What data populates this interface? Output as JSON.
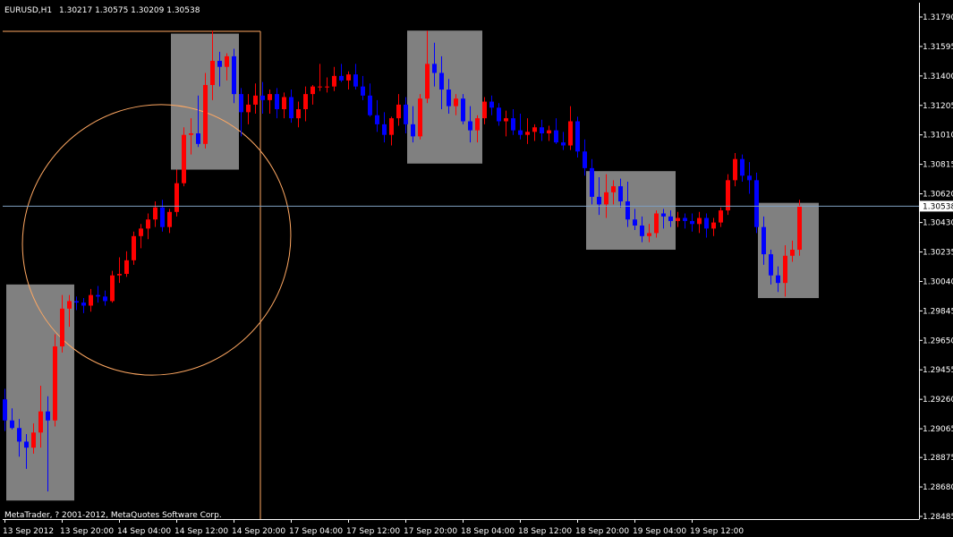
{
  "header": {
    "symbol": "EURUSD,H1",
    "ohlc": "1.30217 1.30575 1.30209 1.30538"
  },
  "copyright": "MetaTrader, ? 2001-2012, MetaQuotes Software Corp.",
  "current_price_label": "1.30538",
  "colors": {
    "background": "#000000",
    "axis": "#ffffff",
    "bull": "#ff0000",
    "bear": "#0000ff",
    "highlight": "#808080",
    "ellipse": "#ffa862",
    "price_line": "#7f9fbf"
  },
  "chart_data": {
    "type": "candlestick",
    "y_ticks": [
      "1.31790",
      "1.31595",
      "1.31400",
      "1.31205",
      "1.31010",
      "1.30815",
      "1.30620",
      "1.30430",
      "1.30235",
      "1.30040",
      "1.29845",
      "1.29650",
      "1.29455",
      "1.29260",
      "1.29065",
      "1.28875",
      "1.28680",
      "1.28485"
    ],
    "y_tick_values": [
      1.3179,
      1.31595,
      1.314,
      1.31205,
      1.3101,
      1.30815,
      1.3062,
      1.3043,
      1.30235,
      1.3004,
      1.29845,
      1.2965,
      1.29455,
      1.2926,
      1.29065,
      1.28875,
      1.2868,
      1.28485
    ],
    "ylim": [
      1.28485,
      1.3179
    ],
    "x_ticks": [
      "13 Sep 2012",
      "13 Sep 20:00",
      "14 Sep 04:00",
      "14 Sep 12:00",
      "14 Sep 20:00",
      "17 Sep 04:00",
      "17 Sep 12:00",
      "17 Sep 20:00",
      "18 Sep 04:00",
      "18 Sep 12:00",
      "18 Sep 20:00",
      "19 Sep 04:00",
      "19 Sep 12:00"
    ],
    "x_tick_positions": [
      0,
      8,
      16,
      24,
      32,
      40,
      48,
      56,
      64,
      72,
      80,
      88,
      96
    ],
    "candles": [
      [
        1.2926,
        1.2933,
        1.2905,
        1.2912
      ],
      [
        1.2912,
        1.292,
        1.2906,
        1.2907
      ],
      [
        1.2907,
        1.2913,
        1.2888,
        1.2898
      ],
      [
        1.2898,
        1.2903,
        1.288,
        1.2894
      ],
      [
        1.2894,
        1.291,
        1.289,
        1.2904
      ],
      [
        1.2904,
        1.2935,
        1.2894,
        1.2918
      ],
      [
        1.2918,
        1.2928,
        1.2865,
        1.2912
      ],
      [
        1.2912,
        1.2969,
        1.2908,
        1.2961
      ],
      [
        1.2961,
        1.2995,
        1.2957,
        1.2986
      ],
      [
        1.2986,
        1.2995,
        1.2974,
        1.2991
      ],
      [
        1.2991,
        1.2994,
        1.2985,
        1.299
      ],
      [
        1.299,
        1.2993,
        1.2983,
        1.2988
      ],
      [
        1.2988,
        1.2999,
        1.2984,
        1.2995
      ],
      [
        1.2995,
        1.3001,
        1.299,
        1.2994
      ],
      [
        1.2994,
        1.2998,
        1.2988,
        1.2991
      ],
      [
        1.2991,
        1.3011,
        1.299,
        1.3008
      ],
      [
        1.3008,
        1.302,
        1.3003,
        1.3009
      ],
      [
        1.3009,
        1.3024,
        1.3007,
        1.3018
      ],
      [
        1.3018,
        1.3037,
        1.3015,
        1.3034
      ],
      [
        1.3034,
        1.3042,
        1.3026,
        1.3039
      ],
      [
        1.3039,
        1.3049,
        1.3032,
        1.3045
      ],
      [
        1.3045,
        1.3057,
        1.304,
        1.3053
      ],
      [
        1.3053,
        1.3058,
        1.3037,
        1.304
      ],
      [
        1.304,
        1.3052,
        1.3036,
        1.305
      ],
      [
        1.305,
        1.3078,
        1.3047,
        1.3069
      ],
      [
        1.3069,
        1.3106,
        1.3067,
        1.3101
      ],
      [
        1.3101,
        1.3112,
        1.3088,
        1.3102
      ],
      [
        1.3102,
        1.3127,
        1.3093,
        1.3095
      ],
      [
        1.3095,
        1.3142,
        1.3092,
        1.3134
      ],
      [
        1.3134,
        1.317,
        1.3124,
        1.315
      ],
      [
        1.315,
        1.3156,
        1.3133,
        1.3146
      ],
      [
        1.3146,
        1.3155,
        1.3137,
        1.3153
      ],
      [
        1.3153,
        1.3158,
        1.3122,
        1.3128
      ],
      [
        1.3128,
        1.3132,
        1.31,
        1.3116
      ],
      [
        1.3116,
        1.3128,
        1.3108,
        1.3121
      ],
      [
        1.3121,
        1.3135,
        1.3115,
        1.3127
      ],
      [
        1.3127,
        1.3136,
        1.3115,
        1.3124
      ],
      [
        1.3124,
        1.3131,
        1.3115,
        1.3128
      ],
      [
        1.3128,
        1.3132,
        1.3112,
        1.3118
      ],
      [
        1.3118,
        1.3129,
        1.3112,
        1.3126
      ],
      [
        1.3126,
        1.3131,
        1.3109,
        1.3112
      ],
      [
        1.3112,
        1.3123,
        1.3106,
        1.3118
      ],
      [
        1.3118,
        1.3133,
        1.311,
        1.3128
      ],
      [
        1.3128,
        1.3134,
        1.3121,
        1.3133
      ],
      [
        1.3133,
        1.3148,
        1.313,
        1.3133
      ],
      [
        1.3133,
        1.3139,
        1.3129,
        1.3133
      ],
      [
        1.3133,
        1.3146,
        1.313,
        1.314
      ],
      [
        1.314,
        1.3148,
        1.3136,
        1.3137
      ],
      [
        1.3137,
        1.3143,
        1.3131,
        1.3141
      ],
      [
        1.3141,
        1.3148,
        1.3131,
        1.3133
      ],
      [
        1.3133,
        1.314,
        1.3124,
        1.3127
      ],
      [
        1.3127,
        1.3135,
        1.3113,
        1.3114
      ],
      [
        1.3114,
        1.3124,
        1.3103,
        1.3108
      ],
      [
        1.3108,
        1.3116,
        1.3096,
        1.3101
      ],
      [
        1.3101,
        1.3113,
        1.3094,
        1.3112
      ],
      [
        1.3112,
        1.3128,
        1.3107,
        1.3121
      ],
      [
        1.3121,
        1.3126,
        1.3102,
        1.3108
      ],
      [
        1.3108,
        1.312,
        1.3096,
        1.31
      ],
      [
        1.31,
        1.3128,
        1.3098,
        1.3125
      ],
      [
        1.3125,
        1.317,
        1.3122,
        1.3148
      ],
      [
        1.3148,
        1.3162,
        1.3133,
        1.3142
      ],
      [
        1.3142,
        1.3153,
        1.3118,
        1.3131
      ],
      [
        1.3131,
        1.3138,
        1.3115,
        1.312
      ],
      [
        1.312,
        1.3128,
        1.3114,
        1.3125
      ],
      [
        1.3125,
        1.3128,
        1.3108,
        1.311
      ],
      [
        1.311,
        1.312,
        1.3096,
        1.3104
      ],
      [
        1.3104,
        1.3114,
        1.3096,
        1.3112
      ],
      [
        1.3112,
        1.3126,
        1.3108,
        1.3123
      ],
      [
        1.3123,
        1.3127,
        1.3114,
        1.3119
      ],
      [
        1.3119,
        1.3122,
        1.3107,
        1.311
      ],
      [
        1.311,
        1.3117,
        1.31,
        1.3112
      ],
      [
        1.3112,
        1.3118,
        1.3101,
        1.3104
      ],
      [
        1.3104,
        1.3115,
        1.3098,
        1.3101
      ],
      [
        1.3101,
        1.3112,
        1.3095,
        1.3103
      ],
      [
        1.3103,
        1.3108,
        1.3097,
        1.3106
      ],
      [
        1.3106,
        1.3111,
        1.3097,
        1.3102
      ],
      [
        1.3102,
        1.3107,
        1.3097,
        1.3104
      ],
      [
        1.3104,
        1.3112,
        1.3095,
        1.3096
      ],
      [
        1.3096,
        1.3103,
        1.3091,
        1.3094
      ],
      [
        1.3094,
        1.312,
        1.3091,
        1.311
      ],
      [
        1.311,
        1.3113,
        1.3086,
        1.309
      ],
      [
        1.309,
        1.3098,
        1.3074,
        1.3079
      ],
      [
        1.3079,
        1.3085,
        1.3055,
        1.306
      ],
      [
        1.306,
        1.3073,
        1.3048,
        1.3055
      ],
      [
        1.3055,
        1.3075,
        1.3046,
        1.3063
      ],
      [
        1.3063,
        1.3071,
        1.3055,
        1.3067
      ],
      [
        1.3067,
        1.3072,
        1.3053,
        1.3057
      ],
      [
        1.3057,
        1.307,
        1.304,
        1.3045
      ],
      [
        1.3045,
        1.3052,
        1.3038,
        1.3041
      ],
      [
        1.3041,
        1.3047,
        1.303,
        1.3034
      ],
      [
        1.3034,
        1.3042,
        1.303,
        1.3036
      ],
      [
        1.3036,
        1.3051,
        1.3033,
        1.3049
      ],
      [
        1.3049,
        1.3052,
        1.3039,
        1.3047
      ],
      [
        1.3047,
        1.3051,
        1.304,
        1.3044
      ],
      [
        1.3044,
        1.305,
        1.304,
        1.3046
      ],
      [
        1.3046,
        1.3049,
        1.3039,
        1.3044
      ],
      [
        1.3044,
        1.3049,
        1.3037,
        1.3042
      ],
      [
        1.3042,
        1.305,
        1.3036,
        1.3046
      ],
      [
        1.3046,
        1.3049,
        1.3033,
        1.3039
      ],
      [
        1.3039,
        1.3046,
        1.3034,
        1.3043
      ],
      [
        1.3043,
        1.3053,
        1.304,
        1.3051
      ],
      [
        1.3051,
        1.3075,
        1.3048,
        1.3071
      ],
      [
        1.3071,
        1.3089,
        1.3067,
        1.3085
      ],
      [
        1.3085,
        1.3088,
        1.307,
        1.3074
      ],
      [
        1.3074,
        1.3083,
        1.3062,
        1.3071
      ],
      [
        1.3071,
        1.3076,
        1.3036,
        1.304
      ],
      [
        1.304,
        1.3047,
        1.3015,
        1.3022
      ],
      [
        1.3022,
        1.3025,
        1.3002,
        1.3008
      ],
      [
        1.3008,
        1.3014,
        1.2997,
        1.3003
      ],
      [
        1.3003,
        1.3028,
        1.2994,
        1.3021
      ],
      [
        1.3021,
        1.3031,
        1.3017,
        1.3025
      ],
      [
        1.3025,
        1.3058,
        1.3021,
        1.3054
      ]
    ],
    "highlight_boxes": [
      {
        "from": 1,
        "to": 9,
        "price_top": 1.3002,
        "price_bottom": 1.2859
      },
      {
        "from": 24,
        "to": 32,
        "price_top": 1.3168,
        "price_bottom": 1.3078
      },
      {
        "from": 57,
        "to": 66,
        "price_top": 1.317,
        "price_bottom": 1.3082
      },
      {
        "from": 82,
        "to": 93,
        "price_top": 1.3077,
        "price_bottom": 1.3025
      },
      {
        "from": 106,
        "to": 113,
        "price_top": 1.3056,
        "price_bottom": 1.2993
      }
    ],
    "price_line": 1.30538
  }
}
